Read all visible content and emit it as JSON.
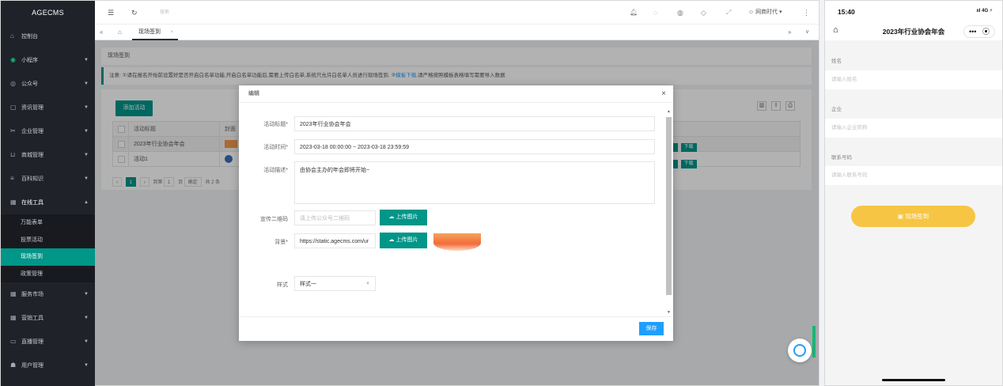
{
  "sidebar": {
    "logo": "AGECMS",
    "items": [
      {
        "label": "控制台",
        "icon": "home-icon"
      },
      {
        "label": "小程序",
        "icon": "circle-icon"
      },
      {
        "label": "公众号",
        "icon": "wechat-icon"
      },
      {
        "label": "资讯管理",
        "icon": "doc-icon"
      },
      {
        "label": "企业管理",
        "icon": "tool-icon"
      },
      {
        "label": "商城管理",
        "icon": "cart-icon"
      },
      {
        "label": "百科知识",
        "icon": "list-icon"
      },
      {
        "label": "在线工具",
        "icon": "grid-icon"
      }
    ],
    "sub_items": [
      "万能表单",
      "投票活动",
      "现场签到",
      "政策管理"
    ],
    "bottom_items": [
      {
        "label": "服务市场",
        "icon": "grid-icon"
      },
      {
        "label": "营销工具",
        "icon": "grid-icon"
      },
      {
        "label": "直播管理",
        "icon": "tv-icon"
      },
      {
        "label": "用户管理",
        "icon": "user-icon"
      }
    ]
  },
  "topbar": {
    "search_placeholder": "搜索",
    "user": "网商时代 ▾"
  },
  "tabs": {
    "current": "现场签到"
  },
  "page": {
    "breadcrumb": "现场签到",
    "notice_prefix": "注意: ①请在报名开始前设置好是否开启白名单功能,开启白名单功能后,需要上传白名单,系统只允许白名单人员进行现场签到. ②",
    "notice_link": "模板下载",
    "notice_suffix": ",请严格按照模板表格填写需要导入数据",
    "add_button": "添加活动",
    "table": {
      "headers": [
        "活动标题",
        "封面"
      ],
      "rows": [
        {
          "title": "2023年行业协会年会"
        },
        {
          "title": "活动1"
        }
      ],
      "action_label": "下载"
    },
    "pager": {
      "current": "1",
      "goto_label": "到第",
      "page_input": "1",
      "page_unit": "页",
      "confirm": "确定",
      "total": "共 2 条"
    }
  },
  "modal": {
    "title": "编辑",
    "fields": {
      "title_label": "活动标题*",
      "title_value": "2023年行业协会年会",
      "time_label": "活动时间*",
      "time_value": "2023-03-18 00:00:00  ~  2023-03-18 23:59:59",
      "desc_label": "活动描述*",
      "desc_value": "由协会主办的年会即将开始~",
      "qrcode_label": "宣传二维码",
      "qrcode_placeholder": "请上传公众号二维码",
      "bg_label": "背景*",
      "bg_value": "https://static.agecms.com/ur",
      "upload_label": "上传图片",
      "style_label": "样式",
      "style_value": "样式一"
    },
    "save": "保存"
  },
  "phone": {
    "time": "15:40",
    "signal": "ııl 4G ⚡",
    "title": "2023年行业协会年会",
    "fields": [
      {
        "label": "姓名",
        "placeholder": "请输入姓名"
      },
      {
        "label": "企业",
        "placeholder": "请输入企业简称"
      },
      {
        "label": "联系号码",
        "placeholder": "请输入联系号码"
      }
    ],
    "submit": "现场签到"
  },
  "colors": {
    "accent": "#009688",
    "sidebar": "#20222a",
    "save": "#1e9fff",
    "phone_button": "#f6c544"
  }
}
